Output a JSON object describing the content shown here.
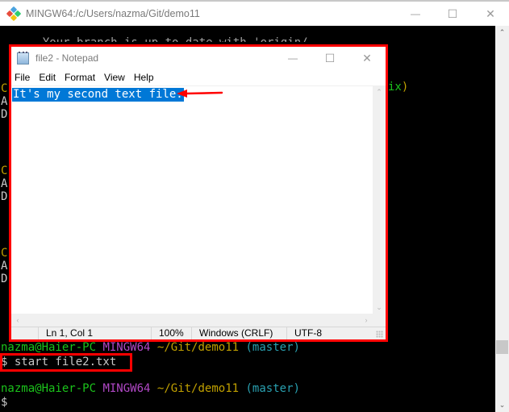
{
  "terminal": {
    "title": "MINGW64:/c/Users/nazma/Git/demo11",
    "controls": {
      "minimize": "—",
      "maximize": "☐",
      "close": "✕"
    },
    "partial_top_line": "  Your branch is up to date with 'origin/...",
    "left_fragments": [
      "C",
      "A",
      "D",
      "C",
      "A",
      "D",
      "C",
      "A",
      "D"
    ],
    "right_fragment": {
      "a": "ix",
      "b": ")"
    },
    "prompt1": {
      "user": "nazma@Haier-PC",
      "shell": "MINGW64",
      "path": "~/Git/demo11",
      "branch": "(master)"
    },
    "command": "$ start file2.txt",
    "prompt2": {
      "user": "nazma@Haier-PC",
      "shell": "MINGW64",
      "path": "~/Git/demo11",
      "branch": "(master)"
    },
    "cursor_line": "$",
    "scroll_up": "⌃",
    "scroll_down": "⌄"
  },
  "notepad": {
    "title": "file2 - Notepad",
    "controls": {
      "minimize": "—",
      "maximize": "☐",
      "close": "✕"
    },
    "menu": [
      "File",
      "Edit",
      "Format",
      "View",
      "Help"
    ],
    "content": "It's my second text file.",
    "status": {
      "position": "Ln 1, Col 1",
      "zoom": "100%",
      "line_ending": "Windows (CRLF)",
      "encoding": "UTF-8"
    },
    "scroll": {
      "up": "⌃",
      "down": "⌄",
      "left": "‹",
      "right": "›"
    }
  },
  "annotation": {
    "color": "#ff0000"
  }
}
